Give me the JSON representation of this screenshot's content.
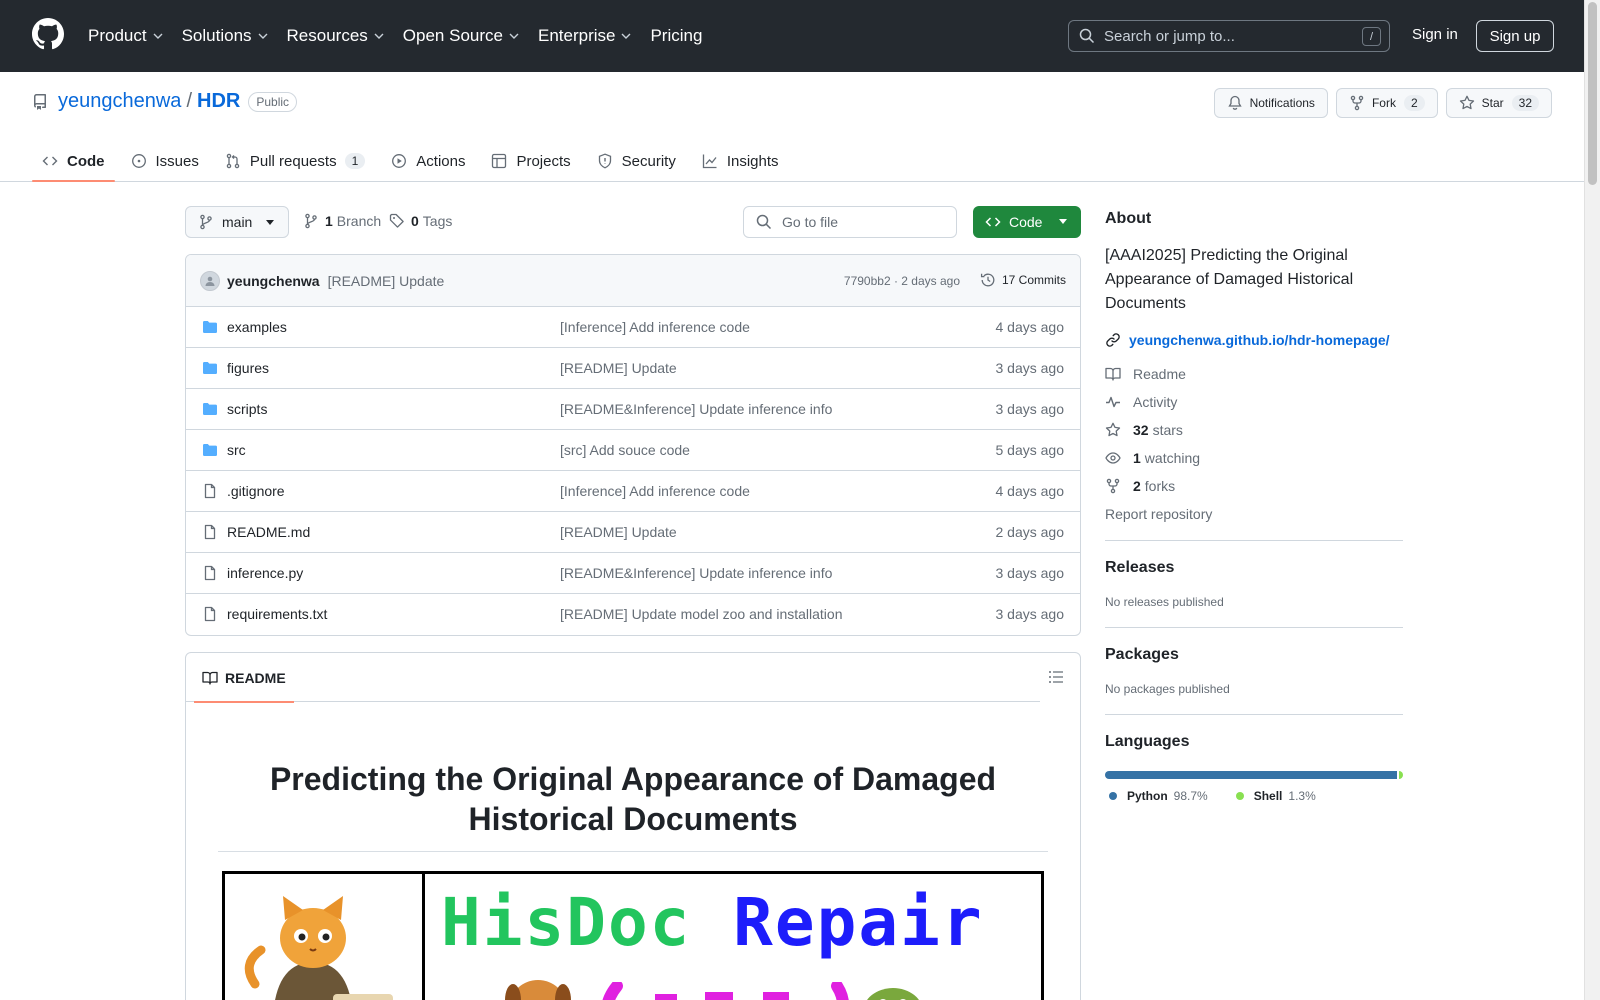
{
  "header": {
    "nav": [
      {
        "label": "Product",
        "has_caret": true
      },
      {
        "label": "Solutions",
        "has_caret": true
      },
      {
        "label": "Resources",
        "has_caret": true
      },
      {
        "label": "Open Source",
        "has_caret": true
      },
      {
        "label": "Enterprise",
        "has_caret": true
      },
      {
        "label": "Pricing",
        "has_caret": false
      }
    ],
    "search_placeholder": "Search or jump to...",
    "search_shortcut": "/",
    "sign_in": "Sign in",
    "sign_up": "Sign up"
  },
  "repo": {
    "owner": "yeungchenwa",
    "separator": "/",
    "name": "HDR",
    "visibility": "Public",
    "notifications_label": "Notifications",
    "fork_label": "Fork",
    "fork_count": "2",
    "star_label": "Star",
    "star_count": "32",
    "tabs": [
      {
        "label": "Code",
        "icon": "code-icon",
        "active": true,
        "count": null
      },
      {
        "label": "Issues",
        "icon": "issue-icon",
        "active": false,
        "count": null
      },
      {
        "label": "Pull requests",
        "icon": "pull-request-icon",
        "active": false,
        "count": "1"
      },
      {
        "label": "Actions",
        "icon": "play-icon",
        "active": false,
        "count": null
      },
      {
        "label": "Projects",
        "icon": "table-icon",
        "active": false,
        "count": null
      },
      {
        "label": "Security",
        "icon": "shield-icon",
        "active": false,
        "count": null
      },
      {
        "label": "Insights",
        "icon": "graph-icon",
        "active": false,
        "count": null
      }
    ]
  },
  "toolbar": {
    "branch": "main",
    "branch_count": "1",
    "branch_label": "Branch",
    "tag_count": "0",
    "tag_label": "Tags",
    "goto_file": "Go to file",
    "code_button": "Code"
  },
  "commit": {
    "author": "yeungchenwa",
    "message": "[README] Update",
    "meta": "7790bb2 · 2 days ago",
    "commits_count": "17 Commits"
  },
  "files": [
    {
      "type": "folder",
      "name": "examples",
      "message": "[Inference] Add inference code",
      "date": "4 days ago"
    },
    {
      "type": "folder",
      "name": "figures",
      "message": "[README] Update",
      "date": "3 days ago"
    },
    {
      "type": "folder",
      "name": "scripts",
      "message": "[README&Inference] Update inference info",
      "date": "3 days ago"
    },
    {
      "type": "folder",
      "name": "src",
      "message": "[src] Add souce code",
      "date": "5 days ago"
    },
    {
      "type": "file",
      "name": ".gitignore",
      "message": "[Inference] Add inference code",
      "date": "4 days ago"
    },
    {
      "type": "file",
      "name": "README.md",
      "message": "[README] Update",
      "date": "2 days ago"
    },
    {
      "type": "file",
      "name": "inference.py",
      "message": "[README&Inference] Update inference info",
      "date": "3 days ago"
    },
    {
      "type": "file",
      "name": "requirements.txt",
      "message": "[README] Update model zoo and installation",
      "date": "3 days ago"
    }
  ],
  "readme": {
    "tab_label": "README",
    "title": "Predicting the Original Appearance of Damaged Historical Documents",
    "banner_text": {
      "word1": "HisDoc",
      "word2": "Repair"
    },
    "colors": {
      "green": "#22c55e",
      "blue": "#1d1dfb",
      "magenta": "#e021e0"
    }
  },
  "sidebar": {
    "about_heading": "About",
    "description": "[AAAI2025] Predicting the Original Appearance of Damaged Historical Documents",
    "homepage": "yeungchenwa.github.io/hdr-homepage/",
    "readme": "Readme",
    "activity": "Activity",
    "stars_count": "32",
    "stars_label": "stars",
    "watching_count": "1",
    "watching_label": "watching",
    "forks_count": "2",
    "forks_label": "forks",
    "report": "Report repository",
    "releases_heading": "Releases",
    "releases_empty": "No releases published",
    "packages_heading": "Packages",
    "packages_empty": "No packages published",
    "languages_heading": "Languages",
    "languages": [
      {
        "name": "Python",
        "percent": "98.7%",
        "value": 98.7,
        "color": "#3572A5"
      },
      {
        "name": "Shell",
        "percent": "1.3%",
        "value": 1.3,
        "color": "#89e051"
      }
    ]
  }
}
